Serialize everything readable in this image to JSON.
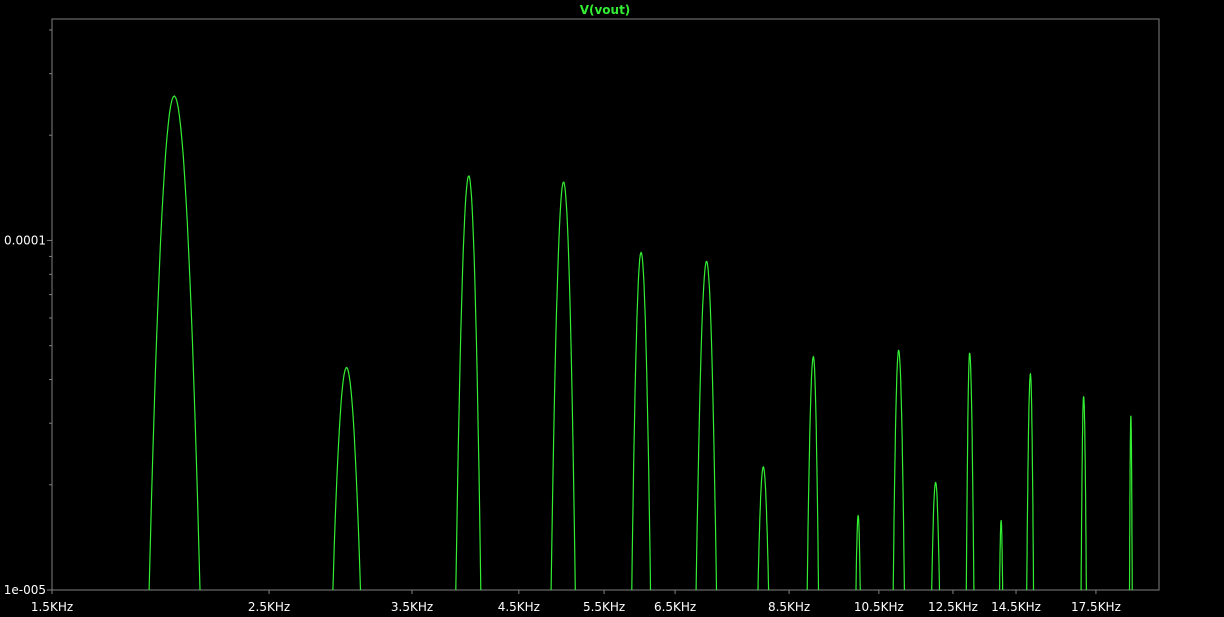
{
  "chart_data": {
    "type": "line",
    "title": "V(vout)",
    "xlabel": "",
    "ylabel": "",
    "x_scale": "log",
    "y_scale": "log",
    "xlim": [
      1500,
      20300
    ],
    "ylim": [
      1e-05,
      0.00043
    ],
    "grid": false,
    "colors": {
      "background": "#000000",
      "axes": "#808080",
      "trace": "#33ee33",
      "text": "#ffffff"
    },
    "x_ticks": [
      {
        "value": 1500,
        "label": "1.5KHz"
      },
      {
        "value": 2500,
        "label": "2.5KHz"
      },
      {
        "value": 3500,
        "label": "3.5KHz"
      },
      {
        "value": 4500,
        "label": "4.5KHz"
      },
      {
        "value": 5500,
        "label": "5.5KHz"
      },
      {
        "value": 6500,
        "label": "6.5KHz"
      },
      {
        "value": 8500,
        "label": "8.5KHz"
      },
      {
        "value": 10500,
        "label": "10.5KHz"
      },
      {
        "value": 12500,
        "label": "12.5KHz"
      },
      {
        "value": 14500,
        "label": "14.5KHz"
      },
      {
        "value": 17500,
        "label": "17.5KHz"
      }
    ],
    "y_ticks": [
      {
        "value": 0.0001,
        "label": "0.0001"
      },
      {
        "value": 1e-05,
        "label": "1e-005"
      }
    ],
    "series": [
      {
        "name": "V(vout)",
        "peaks": [
          {
            "f": 2000,
            "v": 0.000259,
            "lo": 1885,
            "hi": 2125
          },
          {
            "f": 3000,
            "v": 4.33e-05,
            "lo": 2905,
            "hi": 3100
          },
          {
            "f": 4000,
            "v": 0.000153,
            "lo": 3880,
            "hi": 4115
          },
          {
            "f": 5000,
            "v": 0.000147,
            "lo": 4855,
            "hi": 5140
          },
          {
            "f": 6000,
            "v": 9.24e-05,
            "lo": 5870,
            "hi": 6135
          },
          {
            "f": 7000,
            "v": 8.72e-05,
            "lo": 6830,
            "hi": 7165
          },
          {
            "f": 8000,
            "v": 2.25e-05,
            "lo": 7900,
            "hi": 8100
          },
          {
            "f": 9000,
            "v": 4.65e-05,
            "lo": 8870,
            "hi": 9110
          },
          {
            "f": 10000,
            "v": 1.63e-05,
            "lo": 9950,
            "hi": 10050
          },
          {
            "f": 11000,
            "v": 4.85e-05,
            "lo": 10860,
            "hi": 11150
          },
          {
            "f": 12000,
            "v": 2.03e-05,
            "lo": 11890,
            "hi": 12110
          },
          {
            "f": 13000,
            "v": 4.76e-05,
            "lo": 12900,
            "hi": 13130
          },
          {
            "f": 14000,
            "v": 1.58e-05,
            "lo": 13950,
            "hi": 14050
          },
          {
            "f": 15000,
            "v": 4.15e-05,
            "lo": 14870,
            "hi": 15110
          },
          {
            "f": 17000,
            "v": 3.58e-05,
            "lo": 16900,
            "hi": 17110
          },
          {
            "f": 19000,
            "v": 3.15e-05,
            "lo": 18940,
            "hi": 19060
          }
        ]
      }
    ]
  }
}
